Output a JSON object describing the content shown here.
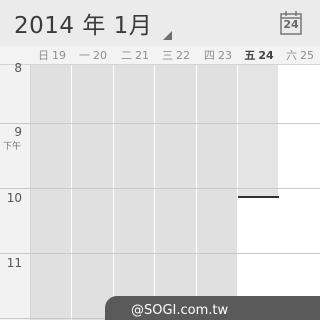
{
  "header": {
    "month_title": "2014 年 1月",
    "today_date": "24"
  },
  "days": [
    {
      "weekday": "日",
      "date": "19"
    },
    {
      "weekday": "一",
      "date": "20"
    },
    {
      "weekday": "二",
      "date": "21"
    },
    {
      "weekday": "三",
      "date": "22"
    },
    {
      "weekday": "四",
      "date": "23"
    },
    {
      "weekday": "五",
      "date": "24"
    },
    {
      "weekday": "六",
      "date": "25"
    }
  ],
  "time_labels": {
    "h8": "8",
    "h9": "9",
    "pm": "下午",
    "h10": "10",
    "h11": "11"
  },
  "watermark": "@SOGI.com.tw",
  "colors": {
    "past_cell": "#e0e0e0",
    "future_cell": "#ffffff",
    "today_cell_past": "#e4e4e4",
    "action_bar": "#ebebeb",
    "current_time_line": "#333333"
  }
}
